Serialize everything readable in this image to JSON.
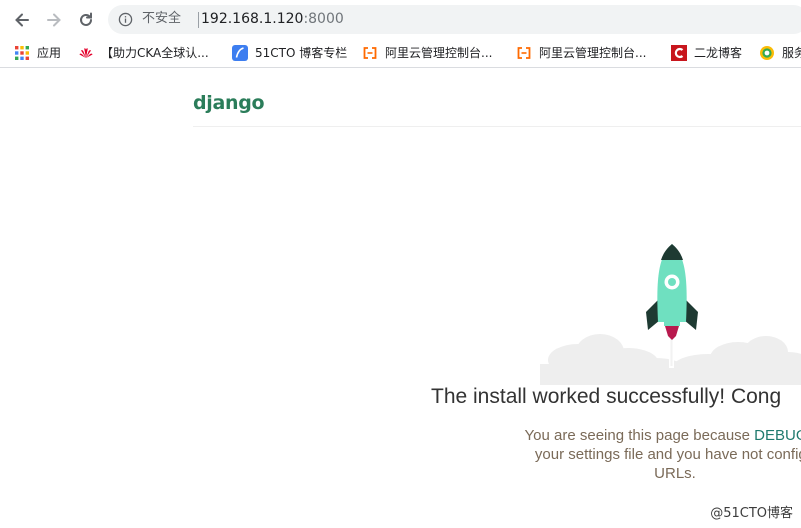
{
  "browser": {
    "nav": {
      "back": "back",
      "forward": "forward",
      "reload": "reload"
    },
    "address_bar": {
      "security_label": "不安全",
      "url_host": "192.168.1.120",
      "url_port": ":8000"
    },
    "bookmarks": [
      {
        "label": "应用",
        "icon": "apps-grid-icon"
      },
      {
        "label": "【助力CKA全球认...",
        "icon": "huawei-logo-icon"
      },
      {
        "label": "51CTO 博客专栏",
        "icon": "feather-icon"
      },
      {
        "label": "阿里云管理控制台...",
        "icon": "aliyun-logo-icon"
      },
      {
        "label": "阿里云管理控制台...",
        "icon": "aliyun-logo-icon"
      },
      {
        "label": "二龙博客",
        "icon": "c-logo-icon"
      },
      {
        "label": "服务",
        "icon": "circle-logo-icon"
      }
    ]
  },
  "page": {
    "logo": "django",
    "headline": "The install worked successfully! Cong",
    "para_line1_prefix": "You are seeing this page because ",
    "para_line1_highlight": "DEBUG=T",
    "para_line2": "your settings file and you have not configu",
    "para_line3": "URLs."
  },
  "watermark": "@51CTO博客",
  "colors": {
    "django_green": "#2b7d5a",
    "rocket_teal": "#6fe0c0",
    "rocket_dark": "#1e3a32",
    "rocket_red": "#b8194e",
    "cloud": "#eeeeee"
  }
}
